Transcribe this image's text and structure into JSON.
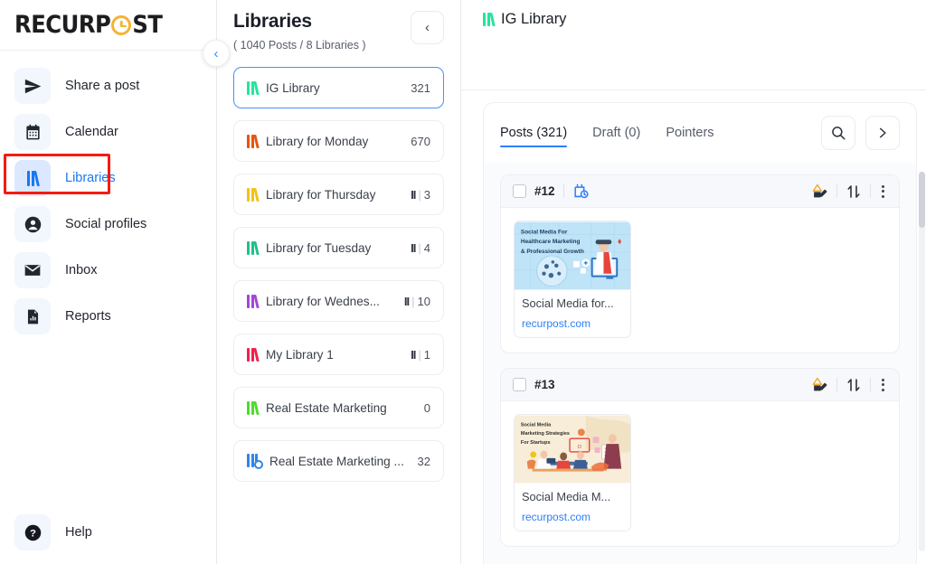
{
  "brand": {
    "name_part1": "RECURP",
    "name_part2": "ST",
    "clock_icon": "clock-icon"
  },
  "sidebar": {
    "items": [
      {
        "label": "Share a post",
        "icon": "send-icon",
        "active": false
      },
      {
        "label": "Calendar",
        "icon": "calendar-icon",
        "active": false
      },
      {
        "label": "Libraries",
        "icon": "books-icon",
        "active": true
      },
      {
        "label": "Social profiles",
        "icon": "user-circle-icon",
        "active": false
      },
      {
        "label": "Inbox",
        "icon": "envelope-icon",
        "active": false
      },
      {
        "label": "Reports",
        "icon": "report-icon",
        "active": false
      }
    ],
    "help": {
      "label": "Help",
      "icon": "question-circle-icon"
    },
    "collapse_button": "chevron-left-icon",
    "highlight_color": "#f61a10"
  },
  "libraries_pane": {
    "title": "Libraries",
    "subtitle": "( 1040 Posts / 8 Libraries )",
    "back_button": "chevron-left-icon",
    "items": [
      {
        "name": "IG Library",
        "count": "321",
        "bars": "",
        "color": "#23e59a",
        "icon": "books-icon",
        "selected": true
      },
      {
        "name": "Library for Monday",
        "count": "670",
        "bars": "",
        "color": "#e8540c",
        "icon": "books-icon",
        "selected": false
      },
      {
        "name": "Library for Thursday",
        "count": "3",
        "bars": "II",
        "color": "#f2c216",
        "icon": "books-icon",
        "selected": false
      },
      {
        "name": "Library for Tuesday",
        "count": "4",
        "bars": "II",
        "color": "#1fc08a",
        "icon": "books-icon",
        "selected": false
      },
      {
        "name": "Library for Wednes...",
        "count": "10",
        "bars": "II",
        "color": "#a246d6",
        "icon": "books-icon",
        "selected": false
      },
      {
        "name": "My Library 1",
        "count": "1",
        "bars": "II",
        "color": "#f0204c",
        "icon": "books-icon",
        "selected": false
      },
      {
        "name": "Real Estate Marketing",
        "count": "0",
        "bars": "",
        "color": "#4ddb2b",
        "icon": "books-icon",
        "selected": false
      },
      {
        "name": "Real Estate Marketing ...",
        "count": "32",
        "bars": "",
        "color": "#2f86e8",
        "icon": "books-clock-icon",
        "selected": false
      }
    ]
  },
  "content": {
    "header_title": "IG Library",
    "header_icon": "books-icon",
    "header_icon_color": "#23e59a",
    "tabs": [
      {
        "label": "Posts (321)",
        "active": true
      },
      {
        "label": "Draft (0)",
        "active": false
      },
      {
        "label": "Pointers",
        "active": false
      }
    ],
    "actions": [
      {
        "name": "search-icon",
        "glyph": "⌕"
      },
      {
        "name": "chevron-right-icon",
        "glyph": "›"
      }
    ],
    "posts": [
      {
        "id": "#12",
        "has_schedule_icon": true,
        "schedule_icon": "calendar-clock-icon",
        "thumb_title_lines": [
          "Social Media For",
          "Healthcare Marketing",
          "& Professional Growth"
        ],
        "caption": "Social Media for...",
        "link": "recurpost.com",
        "thumb_bg": "#bfe3f7"
      },
      {
        "id": "#13",
        "has_schedule_icon": false,
        "schedule_icon": "",
        "thumb_title_lines": [
          "Social Media",
          "Marketing Strategies",
          "For Startups"
        ],
        "caption": "Social Media M...",
        "link": "recurpost.com",
        "thumb_bg": "#f7edd9"
      }
    ],
    "row_icons": {
      "warning": "warning-edit-icon",
      "sort": "sort-updown-icon",
      "menu": "more-vertical-icon"
    }
  }
}
